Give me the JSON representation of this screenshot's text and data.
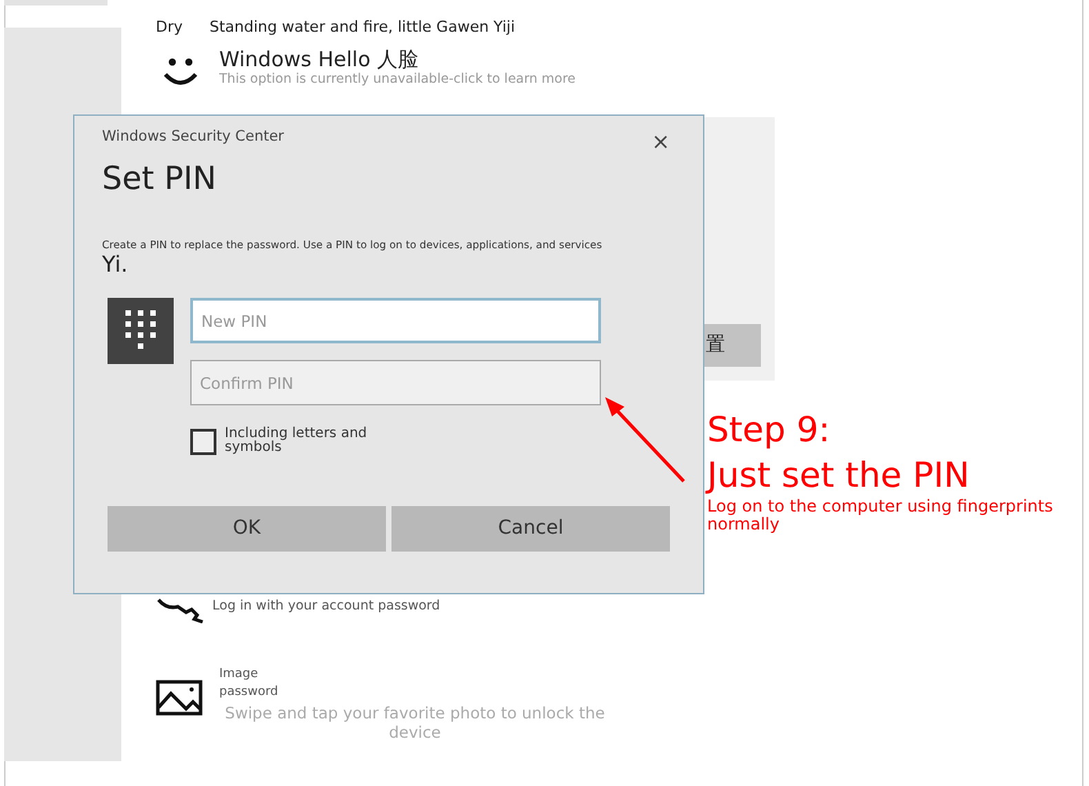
{
  "background": {
    "partial_row": {
      "label": "Dry",
      "text": "Standing water and fire, little Gawen Yiji"
    },
    "sign_in_options": [
      {
        "kind": "face",
        "title": "Windows Hello 人脸",
        "description": "This option is currently unavailable-click to learn more"
      },
      {
        "kind": "key",
        "description": "Log in with your account password"
      },
      {
        "kind": "image",
        "title": "Image password",
        "description": "Swipe and tap your favorite photo to unlock the device"
      }
    ],
    "setup_button": "置"
  },
  "dialog": {
    "app_title": "Windows Security Center",
    "close": "×",
    "title": "Set PIN",
    "description": "Create a PIN to replace the password. Use a PIN to log on to devices, applications, and services",
    "description_continued": "Yi.",
    "fields": [
      {
        "placeholder": "New PIN",
        "focused": true
      },
      {
        "placeholder": "Confirm PIN",
        "focused": false
      }
    ],
    "checkbox": {
      "label": "Including letters and symbols",
      "checked": false
    },
    "buttons": [
      "OK",
      "Cancel"
    ]
  },
  "annotation": {
    "step": "Step 9:",
    "heading": "Just set the PIN",
    "note": "Log on to the computer using fingerprints normally"
  }
}
